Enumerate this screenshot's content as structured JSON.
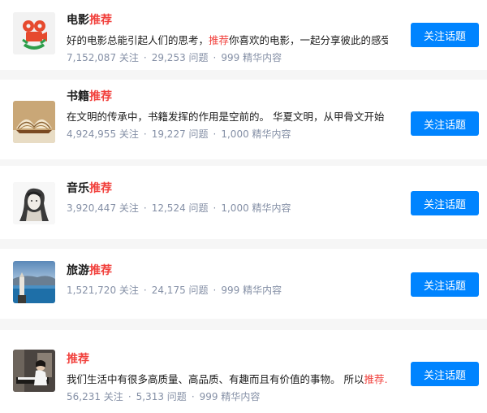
{
  "colors": {
    "accent": "#0084ff",
    "highlight": "#f1403c",
    "meta": "#8590a6"
  },
  "topics": [
    {
      "title_prefix": "电影",
      "title_highlight": "推荐",
      "desc_before": "好的电影总能引起人们的思考，",
      "desc_highlight": "推荐",
      "desc_after": "你喜欢的电影，一起分享彼此的感受",
      "followers": "7,152,087 关注",
      "questions": "29,253 问题",
      "essence": "999 精华内容",
      "follow_label": "关注话题",
      "icon": "film-camera-icon"
    },
    {
      "title_prefix": "书籍",
      "title_highlight": "推荐",
      "desc_before": "在文明的传承中，书籍发挥的作用是空前的。 华夏文明，从甲骨文开始",
      "desc_highlight": "",
      "desc_after": "",
      "followers": "4,924,955 关注",
      "questions": "19,227 问题",
      "essence": "1,000 精华内容",
      "follow_label": "关注话题",
      "icon": "open-book-icon"
    },
    {
      "title_prefix": "音乐",
      "title_highlight": "推荐",
      "desc_before": "",
      "desc_highlight": "",
      "desc_after": "",
      "followers": "3,920,447 关注",
      "questions": "12,524 问题",
      "essence": "1,000 精华内容",
      "follow_label": "关注话题",
      "icon": "sketch-portrait-icon"
    },
    {
      "title_prefix": "旅游",
      "title_highlight": "推荐",
      "desc_before": "",
      "desc_highlight": "",
      "desc_after": "",
      "followers": "1,521,720 关注",
      "questions": "24,175 问题",
      "essence": "999 精华内容",
      "follow_label": "关注话题",
      "icon": "lighthouse-seascape-icon"
    },
    {
      "title_prefix": "",
      "title_highlight": "推荐",
      "desc_before": "我们生活中有很多高质量、高品质、有趣而且有价值的事物。 所以",
      "desc_highlight": "推荐…",
      "desc_after": "",
      "followers": "56,231 关注",
      "questions": "5,313 问题",
      "essence": "999 精华内容",
      "follow_label": "关注话题",
      "icon": "piano-player-icon"
    }
  ],
  "separator": "·"
}
